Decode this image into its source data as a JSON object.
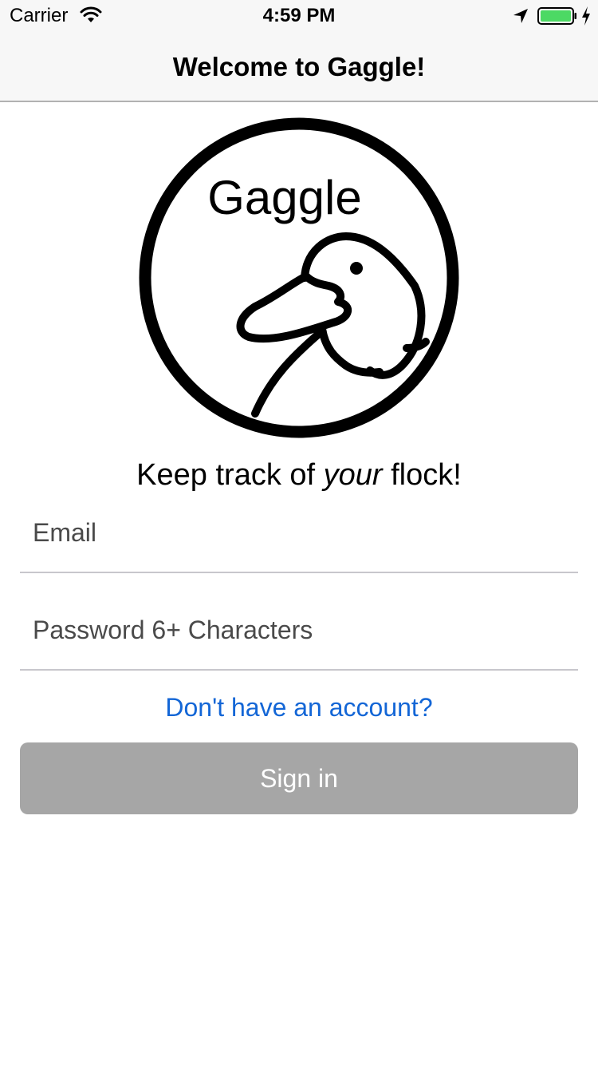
{
  "status_bar": {
    "carrier": "Carrier",
    "time": "4:59 PM",
    "battery_color": "#4cd964",
    "icons": [
      "wifi-icon",
      "location-arrow-icon",
      "battery-icon",
      "charging-bolt-icon"
    ]
  },
  "nav": {
    "title": "Welcome to Gaggle!"
  },
  "logo": {
    "text": "Gaggle",
    "icon": "goose-head-icon"
  },
  "tagline": {
    "before": "Keep track of ",
    "emphasis": "your",
    "after": " flock!"
  },
  "form": {
    "email_placeholder": "Email",
    "email_value": "",
    "password_placeholder": "Password 6+ Characters",
    "password_value": ""
  },
  "signup_link": "Don't have an account?",
  "signin_button": {
    "label": "Sign in",
    "color": "#a6a6a6"
  },
  "colors": {
    "link": "#1366d6",
    "nav_background": "#f7f7f7"
  }
}
